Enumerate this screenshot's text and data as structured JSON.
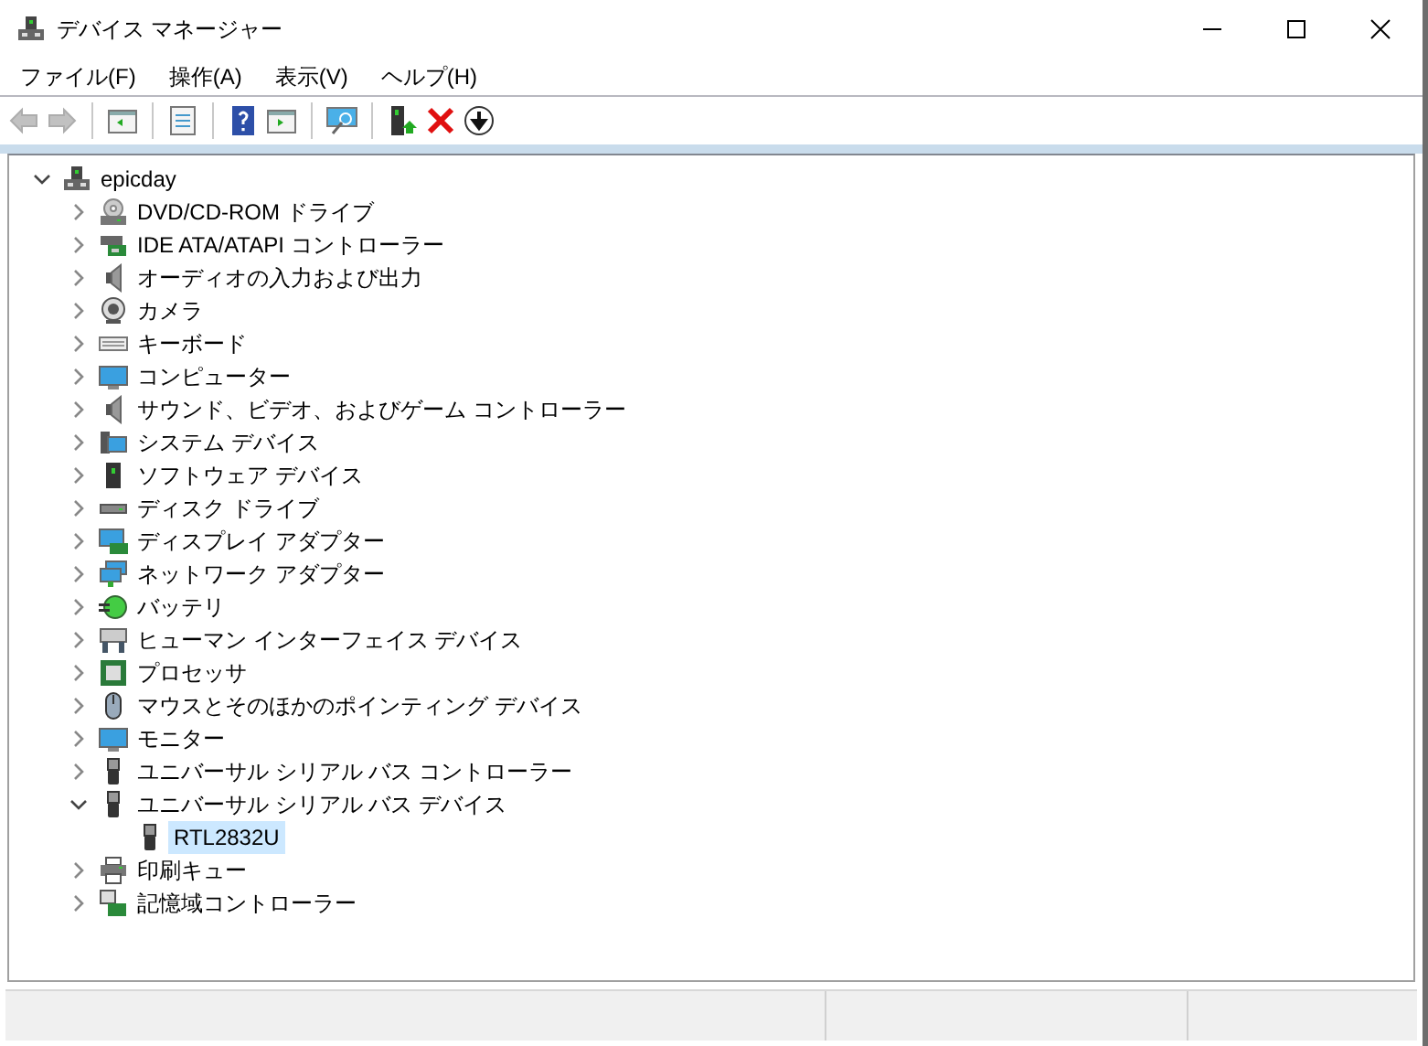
{
  "window": {
    "title": "デバイス マネージャー"
  },
  "menu": [
    "ファイル(F)",
    "操作(A)",
    "表示(V)",
    "ヘルプ(H)"
  ],
  "tree": {
    "label": "epicday",
    "kind": "computer",
    "expanded": true,
    "selected": false,
    "children": [
      {
        "label": "DVD/CD-ROM ドライブ",
        "kind": "dvd",
        "expanded": false,
        "selected": false
      },
      {
        "label": "IDE ATA/ATAPI コントローラー",
        "kind": "ide",
        "expanded": false,
        "selected": false
      },
      {
        "label": "オーディオの入力および出力",
        "kind": "speaker",
        "expanded": false,
        "selected": false
      },
      {
        "label": "カメラ",
        "kind": "camera",
        "expanded": false,
        "selected": false
      },
      {
        "label": "キーボード",
        "kind": "keyboard",
        "expanded": false,
        "selected": false
      },
      {
        "label": "コンピューター",
        "kind": "monitor",
        "expanded": false,
        "selected": false
      },
      {
        "label": "サウンド、ビデオ、およびゲーム コントローラー",
        "kind": "speaker",
        "expanded": false,
        "selected": false
      },
      {
        "label": "システム デバイス",
        "kind": "system",
        "expanded": false,
        "selected": false
      },
      {
        "label": "ソフトウェア デバイス",
        "kind": "software",
        "expanded": false,
        "selected": false
      },
      {
        "label": "ディスク ドライブ",
        "kind": "disk",
        "expanded": false,
        "selected": false
      },
      {
        "label": "ディスプレイ アダプター",
        "kind": "display",
        "expanded": false,
        "selected": false
      },
      {
        "label": "ネットワーク アダプター",
        "kind": "network",
        "expanded": false,
        "selected": false
      },
      {
        "label": "バッテリ",
        "kind": "battery",
        "expanded": false,
        "selected": false
      },
      {
        "label": "ヒューマン インターフェイス デバイス",
        "kind": "hid",
        "expanded": false,
        "selected": false
      },
      {
        "label": "プロセッサ",
        "kind": "cpu",
        "expanded": false,
        "selected": false
      },
      {
        "label": "マウスとそのほかのポインティング デバイス",
        "kind": "mouse",
        "expanded": false,
        "selected": false
      },
      {
        "label": "モニター",
        "kind": "monitor",
        "expanded": false,
        "selected": false
      },
      {
        "label": "ユニバーサル シリアル バス コントローラー",
        "kind": "usb",
        "expanded": false,
        "selected": false
      },
      {
        "label": "ユニバーサル シリアル バス デバイス",
        "kind": "usb",
        "expanded": true,
        "selected": false,
        "children": [
          {
            "label": "RTL2832U",
            "kind": "usb",
            "selected": true
          }
        ]
      },
      {
        "label": "印刷キュー",
        "kind": "printer",
        "expanded": false,
        "selected": false
      },
      {
        "label": "記憶域コントローラー",
        "kind": "storage",
        "expanded": false,
        "selected": false
      }
    ]
  }
}
